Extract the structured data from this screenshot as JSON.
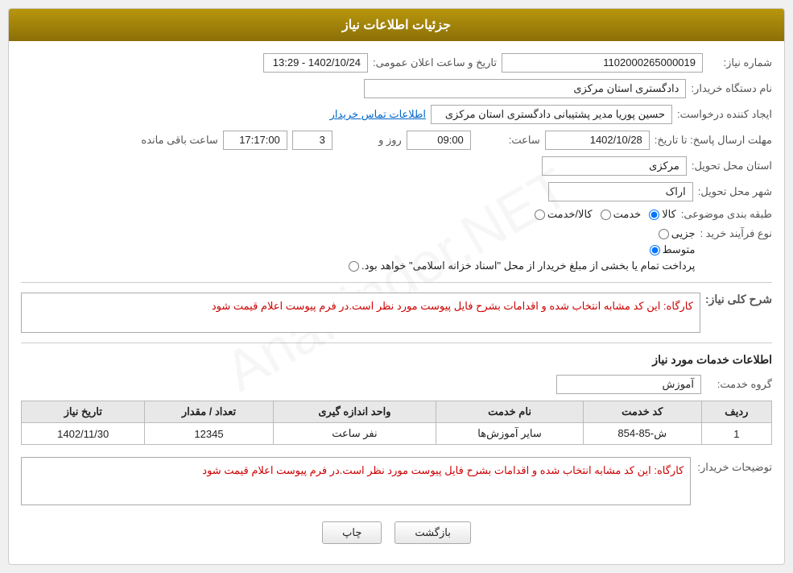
{
  "header": {
    "title": "جزئیات اطلاعات نیاز"
  },
  "form": {
    "shomareNiaz_label": "شماره نیاز:",
    "shomareNiaz_value": "1102000265000019",
    "tarikhoSaat_label": "تاریخ و ساعت اعلان عمومی:",
    "tarikhoSaat_value": "1402/10/24 - 13:29",
    "namDastgah_label": "نام دستگاه خریدار:",
    "namDastgah_value": "دادگستری استان مرکزی",
    "ijadKonande_label": "ایجاد کننده درخواست:",
    "ijadKonande_value": "حسین پوریا مدیر پشتیبانی دادگستری استان مرکزی",
    "amar_tamas_label": "اطلاعات تماس خریدار",
    "mohlat_label": "مهلت ارسال پاسخ: تا تاریخ:",
    "mohlat_date": "1402/10/28",
    "mohlat_saat_label": "ساعت:",
    "mohlat_saat": "09:00",
    "mohlat_rooz_label": "روز و",
    "mohlat_rooz": "3",
    "mohlat_saat2_label": "ساعت باقی مانده",
    "mohlat_saat2": "17:17:00",
    "ostan_tahvil_label": "استان محل تحویل:",
    "ostan_tahvil_value": "مرکزی",
    "shahr_tahvil_label": "شهر محل تحویل:",
    "shahr_tahvil_value": "اراک",
    "tabaghebandi_label": "طبقه بندی موضوعی:",
    "tabaghebandi_options": [
      {
        "id": "kala",
        "label": "کالا",
        "checked": true
      },
      {
        "id": "khadamat",
        "label": "خدمت",
        "checked": false
      },
      {
        "id": "kala_khadamat",
        "label": "کالا/خدمت",
        "checked": false
      }
    ],
    "noeFarayand_label": "نوع فرآیند خرید :",
    "noeFarayand_options": [
      {
        "id": "jozvi",
        "label": "جزیی",
        "checked": false
      },
      {
        "id": "motavaset",
        "label": "متوسط",
        "checked": true
      },
      {
        "id": "other",
        "label": "پرداخت تمام یا بخشی از مبلغ خریدار از محل \"اسناد خزانه اسلامی\" خواهد بود.",
        "checked": false
      }
    ],
    "sharh_label": "شرح کلی نیاز:",
    "sharh_value": "کارگاه: این کد مشابه انتخاب شده و اقدامات  بشرح فایل پیوست مورد نظر است.در فرم پیوست اعلام قیمت شود",
    "khadamat_section_title": "اطلاعات خدمات مورد نیاز",
    "grohe_khadamat_label": "گروه خدمت:",
    "grohe_khadamat_value": "آموزش",
    "table": {
      "headers": [
        "ردیف",
        "کد خدمت",
        "نام خدمت",
        "واحد اندازه گیری",
        "تعداد / مقدار",
        "تاریخ نیاز"
      ],
      "rows": [
        {
          "radif": "1",
          "kod": "ش-85-854",
          "name": "سایر آموزش‌ها",
          "vahed": "نفر ساعت",
          "tedad": "12345",
          "tarikh": "1402/11/30"
        }
      ]
    },
    "buyer_desc_label": "توضیحات خریدار:",
    "buyer_desc_value": "کارگاه: این کد مشابه انتخاب شده و اقدامات  بشرح فایل پیوست مورد نظر است.در فرم پیوست اعلام قیمت شود"
  },
  "buttons": {
    "print_label": "چاپ",
    "back_label": "بازگشت"
  }
}
